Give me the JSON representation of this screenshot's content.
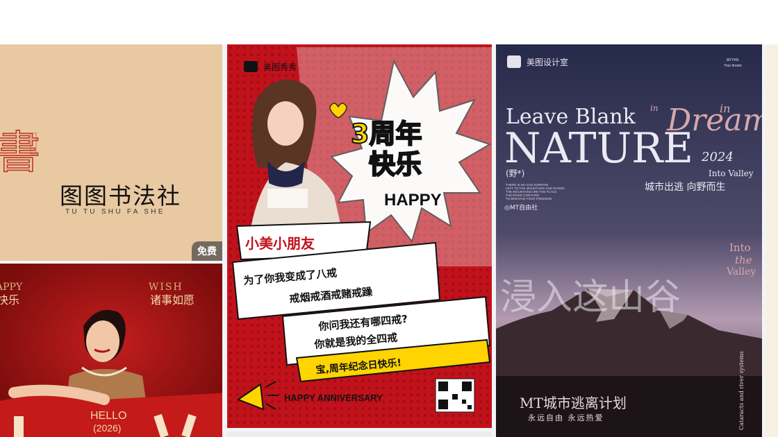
{
  "header": {},
  "cards": {
    "calligraphy": {
      "seal_char": "書",
      "title": "图图书法社",
      "subtitle": "TU TU SHU FA SHE",
      "badge": "免费"
    },
    "red_fashion": {
      "happy": "APPY",
      "left_cn": "快乐",
      "wish": "WISH",
      "right_cn": "诸事如愿",
      "hello": "HELLO",
      "year": "(2026)"
    },
    "anniversary": {
      "brand": "美图秀秀",
      "big_title_1": "3周年",
      "big_title_2": "快乐",
      "happy": "HAPPY",
      "name": "小美小朋友",
      "line1": "为了你我变成了八戒",
      "line2": "戒烟戒酒戒赌戒躁",
      "line3": "你问我还有哪四戒?",
      "line4": "你就是我的全四戒",
      "line5": "宝,周年纪念日快乐!",
      "footer": "HAPPY ANNIVERSARY"
    },
    "nature": {
      "brand": "美图设计室",
      "tag_top": "MTYHS",
      "tag_bottom": "Your dream",
      "leave_blank": "Leave Blank",
      "in_small": "in",
      "dream": "Dream",
      "in_right": "in",
      "nature": "NATURE",
      "year": "2024",
      "wild": "(野*)",
      "into_valley": "Into Valley",
      "slogan": "城市出逃 向野而生",
      "small_lines": [
        "THERE IS NO SAD SORROW",
        "LEFT TO THE MOUNTAINS AND RIVERS",
        "THE MOUNTAINS ARE THE PLACE",
        "THE RIVER CONTAINS",
        "TO BREATHE YOUR FREEDOM"
      ],
      "club": "◎MT自由社",
      "into": "Into",
      "the": "the",
      "valley": "Valley",
      "big_cn": "浸入这山谷",
      "plan": "MT城市逃离计划",
      "plan_sub": "永远自由  永远热爱",
      "side_text": "Cataracts and river systems"
    }
  },
  "colors": {
    "calligraphy_bg": "#e8c9a2",
    "seal_red": "#c0392b",
    "anniversary_red": "#c1121c",
    "accent_yellow": "#ffd400",
    "nature_sky": "#2a2f52"
  }
}
